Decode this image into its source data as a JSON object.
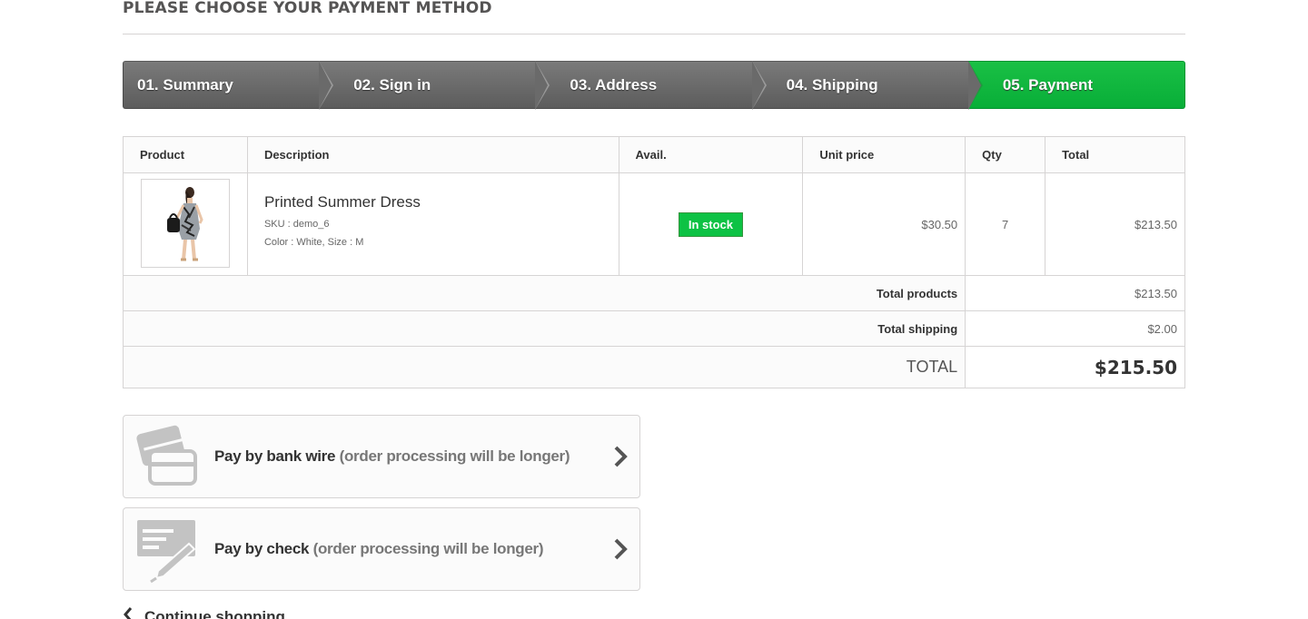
{
  "page": {
    "heading": "Please choose your payment method"
  },
  "steps": [
    {
      "label": "01. Summary"
    },
    {
      "label": "02. Sign in"
    },
    {
      "label": "03. Address"
    },
    {
      "label": "04. Shipping"
    },
    {
      "label": "05. Payment",
      "active": true
    }
  ],
  "cart": {
    "headers": {
      "product": "Product",
      "description": "Description",
      "avail": "Avail.",
      "unit_price": "Unit price",
      "qty": "Qty",
      "total": "Total"
    },
    "items": [
      {
        "name": "Printed Summer Dress",
        "sku": "SKU : demo_6",
        "attributes": "Color : White, Size : M",
        "availability": "In stock",
        "unit_price": "$30.50",
        "qty": "7",
        "total": "$213.50",
        "image_icon": "dress-product-thumbnail"
      }
    ],
    "totals": {
      "products_label": "Total products",
      "products_value": "$213.50",
      "shipping_label": "Total shipping",
      "shipping_value": "$2.00",
      "total_label": "TOTAL",
      "total_value": "$215.50"
    }
  },
  "payment_options": [
    {
      "method": "Pay by bank wire",
      "note": "(order processing will be longer)",
      "icon": "bank-card-icon"
    },
    {
      "method": "Pay by check",
      "note": "(order processing will be longer)",
      "icon": "check-pen-icon"
    }
  ],
  "continue": {
    "label": "Continue shopping"
  },
  "colors": {
    "accent_green": "#0dc244",
    "step_gray": "#6a6a6a",
    "border": "#d6d4d4"
  }
}
